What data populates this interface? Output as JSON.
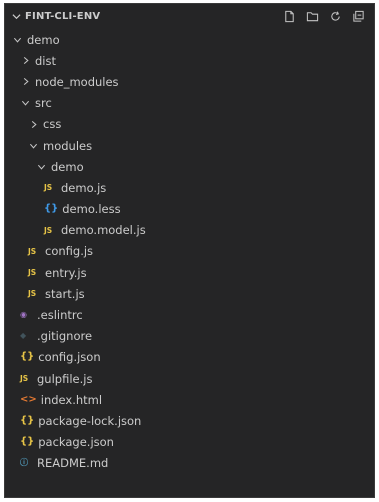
{
  "explorer": {
    "title": "FINT-CLI-ENV",
    "actions": [
      {
        "name": "new-file-icon"
      },
      {
        "name": "new-folder-icon"
      },
      {
        "name": "refresh-icon"
      },
      {
        "name": "collapse-all-icon"
      }
    ]
  },
  "tree": [
    {
      "label": "demo",
      "depth": 0,
      "type": "folder",
      "open": true
    },
    {
      "label": "dist",
      "depth": 1,
      "type": "folder",
      "open": false
    },
    {
      "label": "node_modules",
      "depth": 1,
      "type": "folder",
      "open": false
    },
    {
      "label": "src",
      "depth": 1,
      "type": "folder",
      "open": true
    },
    {
      "label": "css",
      "depth": 2,
      "type": "folder",
      "open": false
    },
    {
      "label": "modules",
      "depth": 2,
      "type": "folder",
      "open": true
    },
    {
      "label": "demo",
      "depth": 3,
      "type": "folder",
      "open": true
    },
    {
      "label": "demo.js",
      "depth": 4,
      "type": "file",
      "icon": "js"
    },
    {
      "label": "demo.less",
      "depth": 4,
      "type": "file",
      "icon": "braces"
    },
    {
      "label": "demo.model.js",
      "depth": 4,
      "type": "file",
      "icon": "js"
    },
    {
      "label": "config.js",
      "depth": 2,
      "type": "file",
      "icon": "js"
    },
    {
      "label": "entry.js",
      "depth": 2,
      "type": "file",
      "icon": "js"
    },
    {
      "label": "start.js",
      "depth": 2,
      "type": "file",
      "icon": "js"
    },
    {
      "label": ".eslintrc",
      "depth": 1,
      "type": "file",
      "icon": "eslint"
    },
    {
      "label": ".gitignore",
      "depth": 1,
      "type": "file",
      "icon": "git"
    },
    {
      "label": "config.json",
      "depth": 1,
      "type": "file",
      "icon": "json"
    },
    {
      "label": "gulpfile.js",
      "depth": 1,
      "type": "file",
      "icon": "js"
    },
    {
      "label": "index.html",
      "depth": 1,
      "type": "file",
      "icon": "html"
    },
    {
      "label": "package-lock.json",
      "depth": 1,
      "type": "file",
      "icon": "json"
    },
    {
      "label": "package.json",
      "depth": 1,
      "type": "file",
      "icon": "json"
    },
    {
      "label": "README.md",
      "depth": 1,
      "type": "file",
      "icon": "info"
    }
  ],
  "icon_glyphs": {
    "js": "JS",
    "braces": "{}",
    "json": "{}",
    "html": "<>",
    "git": "◆",
    "eslint": "◉",
    "info": "ⓘ"
  },
  "colors": {
    "background": "#252526",
    "text": "#cccccc",
    "js": "#e8c547",
    "less": "#3f9ae8",
    "json": "#e8c547",
    "html": "#e37933",
    "eslint": "#a074c4",
    "info": "#519aba"
  }
}
